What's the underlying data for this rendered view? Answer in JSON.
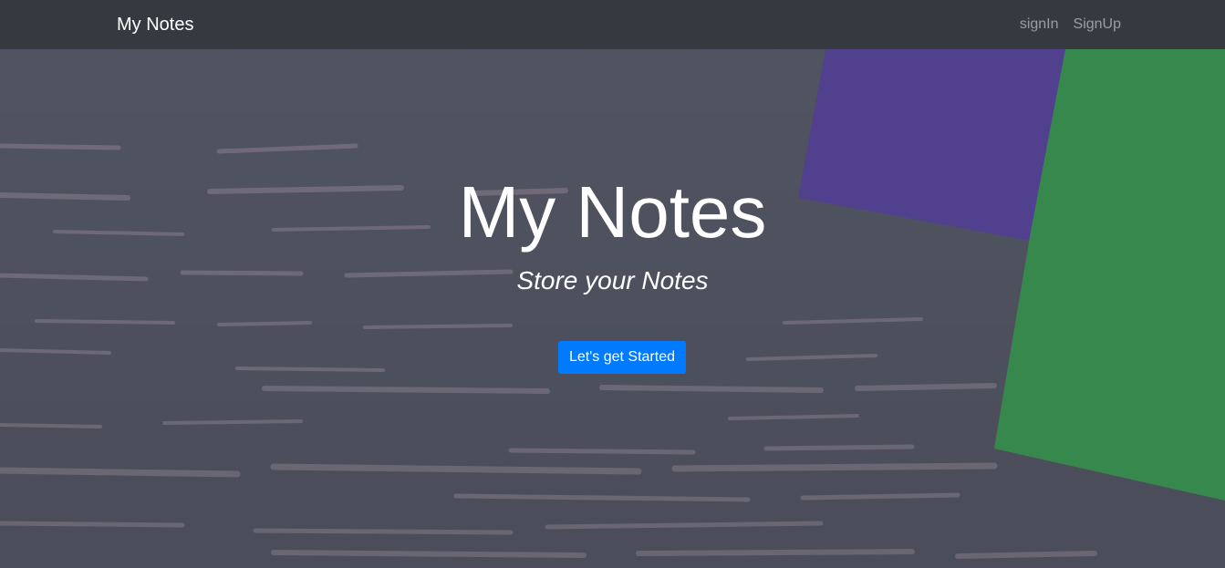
{
  "navbar": {
    "brand": "My Notes",
    "links": [
      "signIn",
      "SignUp"
    ]
  },
  "hero": {
    "title": "My Notes",
    "subtitle": "Store your Notes",
    "cta_label": "Let's get Started",
    "background_image": "chalkboard with purple and green felt squares"
  },
  "colors": {
    "navbar": "#343a40",
    "accent": "#007bff",
    "board": "#5a5d6c",
    "purple_felt": "#5b4aa0",
    "green_felt": "#3e9b58"
  }
}
